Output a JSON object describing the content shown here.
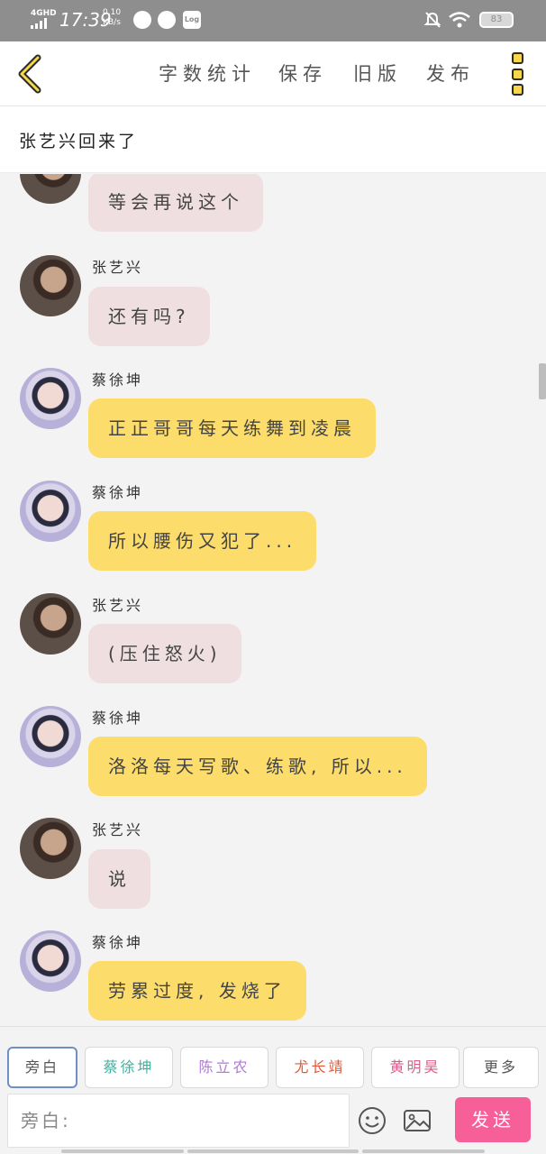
{
  "status_bar": {
    "network": "4GHD",
    "time": "17:39",
    "speed_value": "0.10",
    "speed_unit": "KB/s",
    "log_label": "Log",
    "battery": "83"
  },
  "toolbar": {
    "word_count": "字数统计",
    "save": "保存",
    "old_version": "旧版",
    "publish": "发布"
  },
  "title": "张艺兴回来了",
  "messages": [
    {
      "speaker": "",
      "text": "等会再说这个",
      "style": "pink",
      "avatar": "zyx-avatar"
    },
    {
      "speaker": "张艺兴",
      "text": "还有吗?",
      "style": "pink",
      "avatar": "zyx-avatar"
    },
    {
      "speaker": "蔡徐坤",
      "text": "正正哥哥每天练舞到凌晨",
      "style": "yellow",
      "avatar": "cxk-avatar"
    },
    {
      "speaker": "蔡徐坤",
      "text": "所以腰伤又犯了...",
      "style": "yellow",
      "avatar": "cxk-avatar"
    },
    {
      "speaker": "张艺兴",
      "text": "(压住怒火)",
      "style": "pink",
      "avatar": "zyx-avatar"
    },
    {
      "speaker": "蔡徐坤",
      "text": "洛洛每天写歌、练歌, 所以...",
      "style": "yellow",
      "avatar": "cxk-avatar"
    },
    {
      "speaker": "张艺兴",
      "text": "说",
      "style": "pink",
      "avatar": "zyx-avatar"
    },
    {
      "speaker": "蔡徐坤",
      "text": "劳累过度, 发烧了",
      "style": "yellow",
      "avatar": "cxk-avatar"
    }
  ],
  "roles": [
    {
      "label": "旁白",
      "color": "#555555"
    },
    {
      "label": "蔡徐坤",
      "color": "#3bb3a0"
    },
    {
      "label": "陈立农",
      "color": "#b07ad8"
    },
    {
      "label": "尤长靖",
      "color": "#e05a3a"
    },
    {
      "label": "黄明昊",
      "color": "#e05a8a"
    },
    {
      "label": "更多",
      "color": "#555555"
    }
  ],
  "input": {
    "placeholder": "旁白:"
  },
  "send_label": "发送",
  "colors": {
    "accent": "#f75f99",
    "bubble_pink": "#f0dfe0",
    "bubble_yellow": "#fcdc6a"
  }
}
